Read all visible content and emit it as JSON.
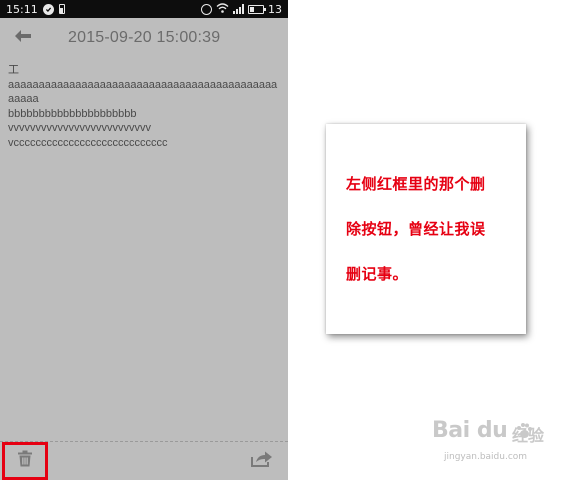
{
  "status_bar": {
    "time": "15:11",
    "battery_level": "13",
    "icons": [
      "check-circle-icon",
      "battery-small-icon",
      "alarm-icon",
      "wifi-icon",
      "signal-icon",
      "battery-icon"
    ]
  },
  "header": {
    "back_icon": "arrow-left-icon",
    "title": "2015-09-20 15:00:39"
  },
  "note": {
    "lines": [
      "工",
      "aaaaaaaaaaaaaaaaaaaaaaaaaaaaaaaaaaaaaaaaaaaaaaaaa",
      "bbbbbbbbbbbbbbbbbbbbb",
      "vvvvvvvvvvvvvvvvvvvvvvvvvv",
      "vcccccccccccccccccccccccccccc"
    ]
  },
  "bottom_bar": {
    "delete_icon": "trash-icon",
    "share_icon": "share-icon",
    "highlight_color": "#e60012"
  },
  "annotation": {
    "lines": [
      "左侧红框里的那个删",
      "除按钮，曾经让我误",
      "删记事。"
    ],
    "text_color": "#e60012"
  },
  "watermark": {
    "logo": "Bai du",
    "brand_cn": "经验",
    "url": "jingyan.baidu.com"
  },
  "colors": {
    "screen_background": "#bdbdbd",
    "status_bar": "#0d0d0d",
    "title_text": "#6b6b6b"
  }
}
